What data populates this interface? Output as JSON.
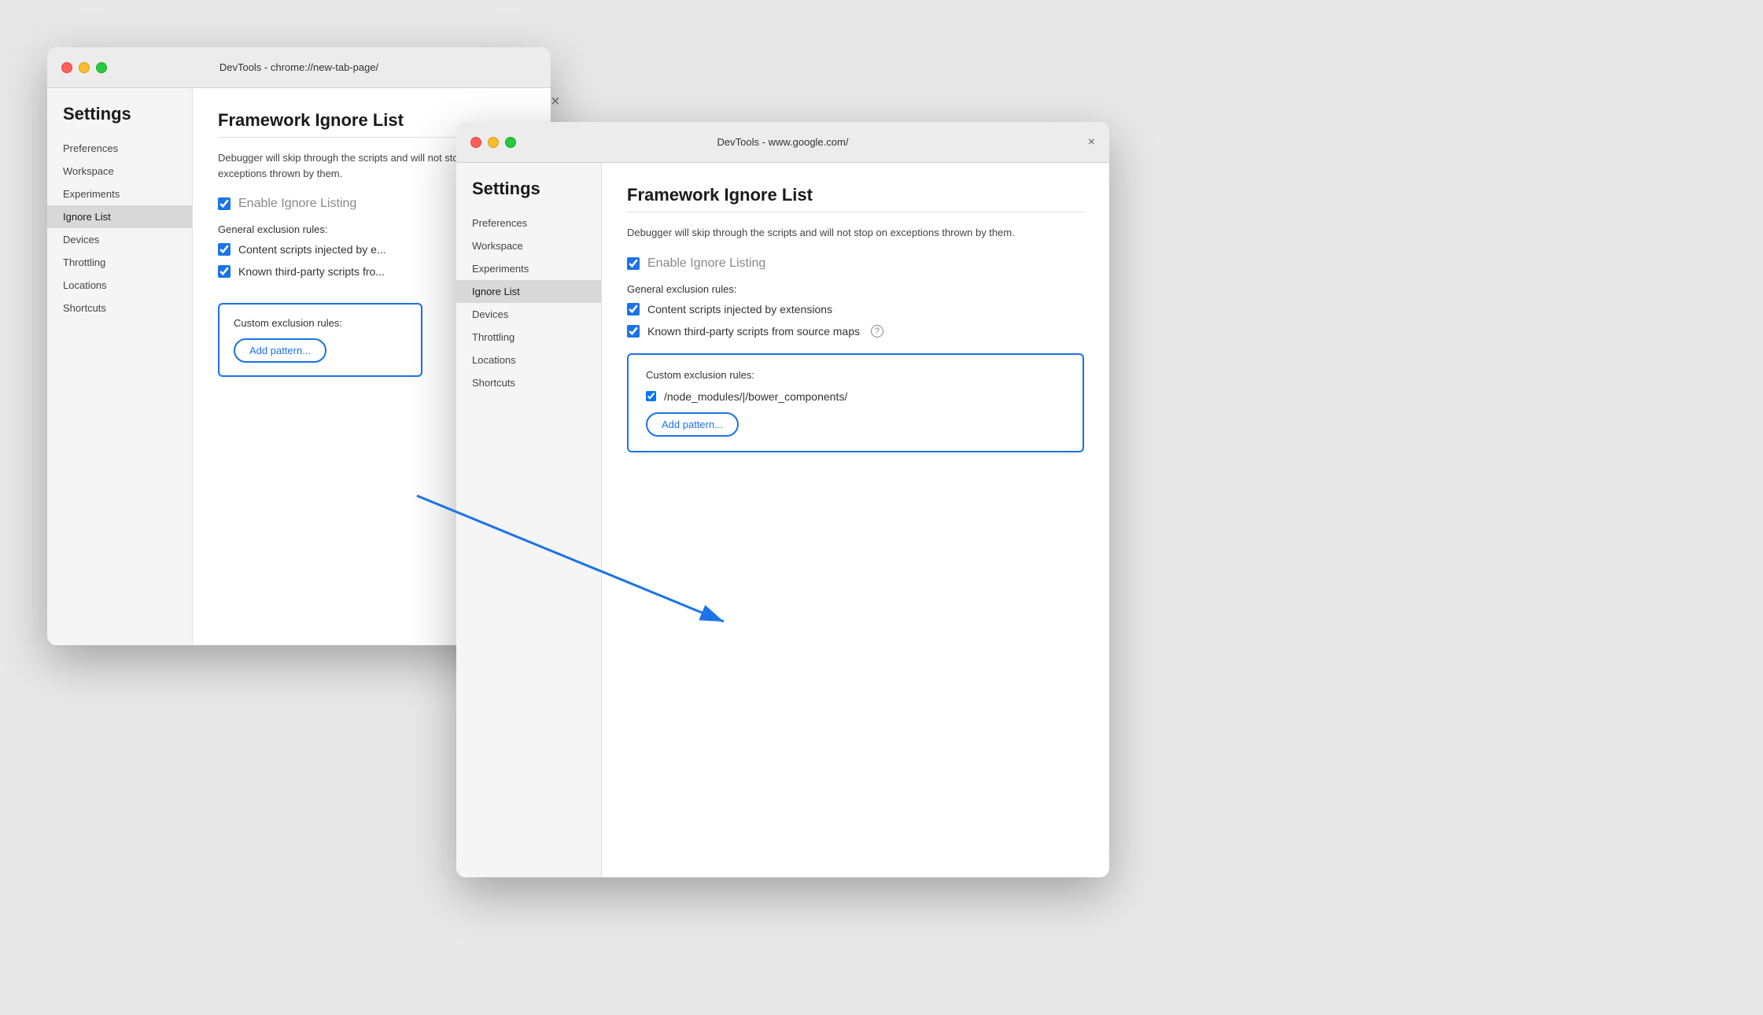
{
  "window1": {
    "titlebar": "DevTools - chrome://new-tab-page/",
    "closeBtn": "×",
    "sidebar": {
      "title": "Settings",
      "items": [
        {
          "label": "Preferences",
          "active": false
        },
        {
          "label": "Workspace",
          "active": false
        },
        {
          "label": "Experiments",
          "active": false
        },
        {
          "label": "Ignore List",
          "active": true
        },
        {
          "label": "Devices",
          "active": false
        },
        {
          "label": "Throttling",
          "active": false
        },
        {
          "label": "Locations",
          "active": false
        },
        {
          "label": "Shortcuts",
          "active": false
        }
      ]
    },
    "main": {
      "title": "Framework Ignore List",
      "desc": "Debugger will skip through the scripts and will not stop on exceptions thrown by them.",
      "enableLabel": "Enable Ignore Listing",
      "generalTitle": "General exclusion rules:",
      "checkboxes": [
        {
          "label": "Content scripts injected by e..."
        },
        {
          "label": "Known third-party scripts fro..."
        }
      ],
      "customTitle": "Custom exclusion rules:",
      "addPatternLabel": "Add pattern..."
    }
  },
  "window2": {
    "titlebar": "DevTools - www.google.com/",
    "closeBtn": "×",
    "sidebar": {
      "title": "Settings",
      "items": [
        {
          "label": "Preferences",
          "active": false
        },
        {
          "label": "Workspace",
          "active": false
        },
        {
          "label": "Experiments",
          "active": false
        },
        {
          "label": "Ignore List",
          "active": true
        },
        {
          "label": "Devices",
          "active": false
        },
        {
          "label": "Throttling",
          "active": false
        },
        {
          "label": "Locations",
          "active": false
        },
        {
          "label": "Shortcuts",
          "active": false
        }
      ]
    },
    "main": {
      "title": "Framework Ignore List",
      "desc": "Debugger will skip through the scripts and will not stop on exceptions thrown by them.",
      "enableLabel": "Enable Ignore Listing",
      "generalTitle": "General exclusion rules:",
      "checkboxes": [
        {
          "label": "Content scripts injected by extensions"
        },
        {
          "label": "Known third-party scripts from source maps"
        }
      ],
      "customTitle": "Custom exclusion rules:",
      "customItem": "/node_modules/|/bower_components/",
      "addPatternLabel": "Add pattern..."
    }
  }
}
